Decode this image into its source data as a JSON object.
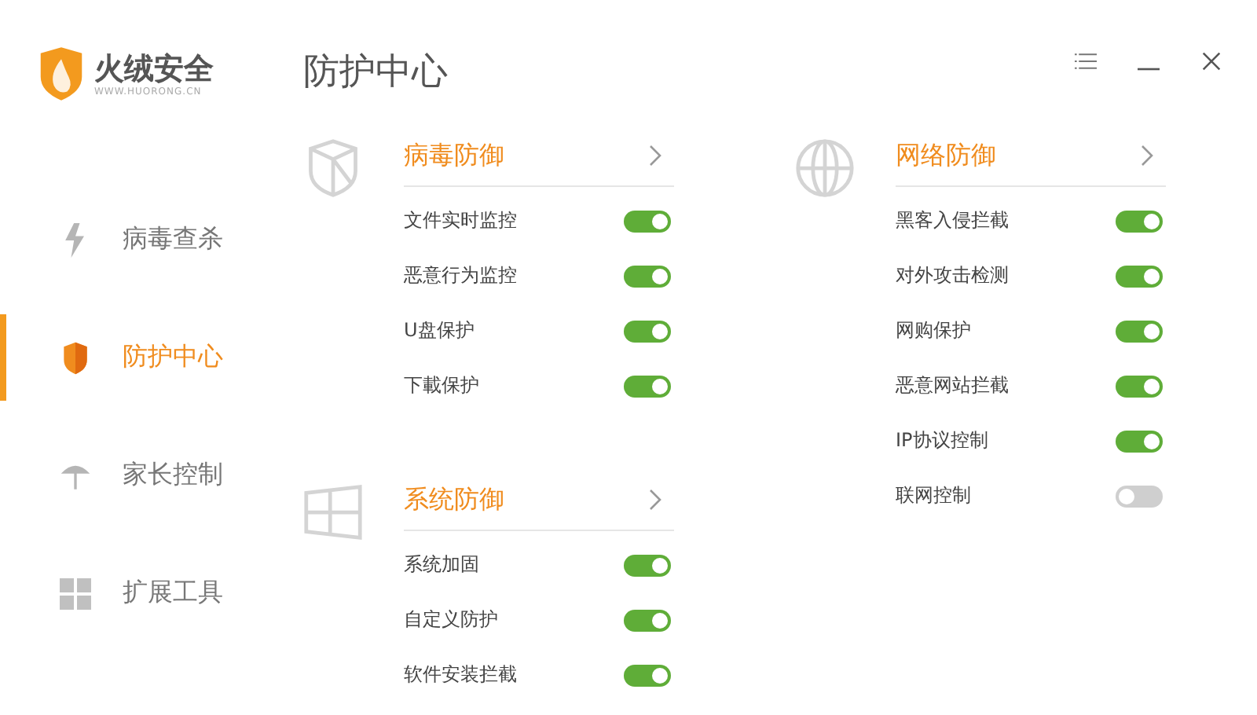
{
  "app": {
    "name": "火绒安全",
    "url": "WWW.HUORONG.CN"
  },
  "page_title": "防护中心",
  "sidebar": {
    "items": [
      {
        "label": "病毒查杀",
        "kind": "bolt",
        "selected": false
      },
      {
        "label": "防护中心",
        "kind": "shield",
        "selected": true
      },
      {
        "label": "家长控制",
        "kind": "umbrella",
        "selected": false
      },
      {
        "label": "扩展工具",
        "kind": "grid",
        "selected": false
      }
    ]
  },
  "columns": [
    [
      {
        "title": "病毒防御",
        "kind": "shield",
        "items": [
          {
            "label": "文件实时监控",
            "on": true
          },
          {
            "label": "恶意行为监控",
            "on": true
          },
          {
            "label": "U盘保护",
            "on": true
          },
          {
            "label": "下載保护",
            "on": true
          }
        ]
      },
      {
        "title": "系统防御",
        "kind": "windows",
        "items": [
          {
            "label": "系统加固",
            "on": true
          },
          {
            "label": "自定义防护",
            "on": true
          },
          {
            "label": "软件安装拦截",
            "on": true
          }
        ]
      }
    ],
    [
      {
        "title": "网络防御",
        "kind": "globe",
        "items": [
          {
            "label": "黑客入侵拦截",
            "on": true
          },
          {
            "label": "对外攻击检测",
            "on": true
          },
          {
            "label": "网购保护",
            "on": true
          },
          {
            "label": "恶意网站拦截",
            "on": true
          },
          {
            "label": "IP协议控制",
            "on": true
          },
          {
            "label": "联网控制",
            "on": false
          }
        ]
      }
    ]
  ]
}
